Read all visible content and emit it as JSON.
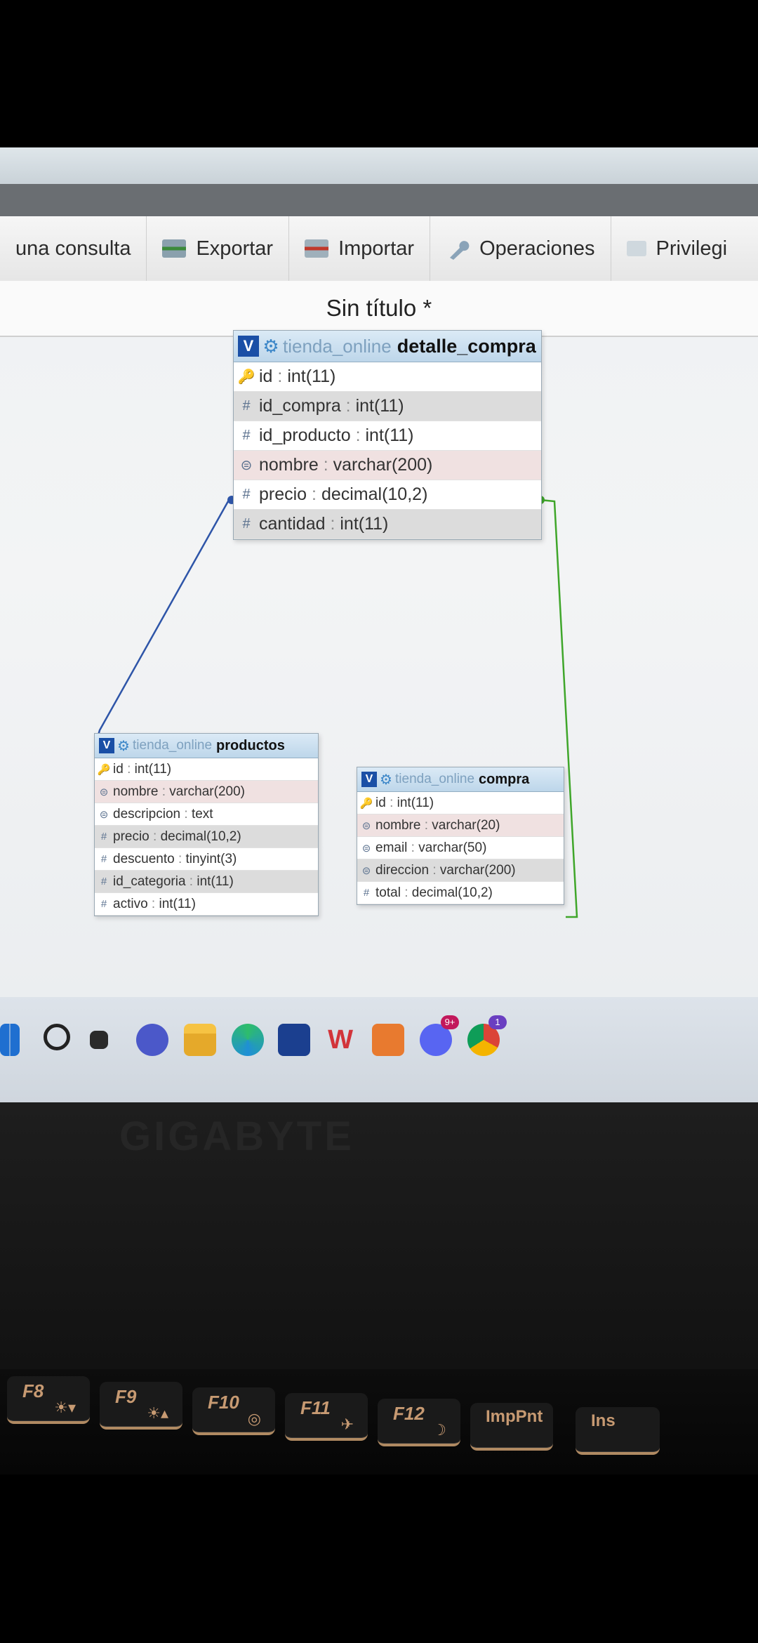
{
  "toolbar": {
    "tabs": [
      {
        "label": "una consulta",
        "icon": "query-icon"
      },
      {
        "label": "Exportar",
        "icon": "export-icon"
      },
      {
        "label": "Importar",
        "icon": "import-icon"
      },
      {
        "label": "Operaciones",
        "icon": "wrench-icon"
      },
      {
        "label": "Privilegi",
        "icon": "privileges-icon"
      }
    ]
  },
  "page": {
    "title": "Sin título *"
  },
  "tables": {
    "detalle_compra": {
      "db": "tienda_online",
      "name": "detalle_compra",
      "columns": [
        {
          "name": "id",
          "type": "int(11)",
          "icon": "key-icon"
        },
        {
          "name": "id_compra",
          "type": "int(11)",
          "icon": "hash-icon"
        },
        {
          "name": "id_producto",
          "type": "int(11)",
          "icon": "hash-icon"
        },
        {
          "name": "nombre",
          "type": "varchar(200)",
          "icon": "text-icon"
        },
        {
          "name": "precio",
          "type": "decimal(10,2)",
          "icon": "hash-icon"
        },
        {
          "name": "cantidad",
          "type": "int(11)",
          "icon": "hash-icon"
        }
      ]
    },
    "productos": {
      "db": "tienda_online",
      "name": "productos",
      "columns": [
        {
          "name": "id",
          "type": "int(11)",
          "icon": "key-icon"
        },
        {
          "name": "nombre",
          "type": "varchar(200)",
          "icon": "text-icon"
        },
        {
          "name": "descripcion",
          "type": "text",
          "icon": "text-icon"
        },
        {
          "name": "precio",
          "type": "decimal(10,2)",
          "icon": "hash-icon"
        },
        {
          "name": "descuento",
          "type": "tinyint(3)",
          "icon": "hash-icon"
        },
        {
          "name": "id_categoria",
          "type": "int(11)",
          "icon": "hash-icon"
        },
        {
          "name": "activo",
          "type": "int(11)",
          "icon": "hash-icon"
        }
      ]
    },
    "compra": {
      "db": "tienda_online",
      "name": "compra",
      "columns": [
        {
          "name": "id",
          "type": "int(11)",
          "icon": "key-icon"
        },
        {
          "name": "nombre",
          "type": "varchar(20)",
          "icon": "text-icon"
        },
        {
          "name": "email",
          "type": "varchar(50)",
          "icon": "text-icon"
        },
        {
          "name": "direccion",
          "type": "varchar(200)",
          "icon": "text-icon"
        },
        {
          "name": "total",
          "type": "decimal(10,2)",
          "icon": "hash-icon"
        }
      ]
    }
  },
  "header_badge": "V",
  "relations": [
    {
      "from": "detalle_compra.id_producto",
      "to": "productos.id",
      "color": "#2e55a8"
    },
    {
      "from": "detalle_compra.id_compra",
      "to": "compra.id",
      "color": "#3fa62a"
    }
  ],
  "taskbar": {
    "apps": [
      "windows-start-icon",
      "search-icon",
      "task-view-icon",
      "teams-chat-icon",
      "file-explorer-icon",
      "edge-icon",
      "store-icon",
      "wps-icon",
      "xampp-icon",
      "discord-icon",
      "chrome-icon"
    ],
    "discord_badge": "9+",
    "chrome_badge": "1"
  },
  "laptop": {
    "brand": "GIGABYTE"
  },
  "keyboard": {
    "keys": [
      {
        "label": "F8",
        "sub": "☀▾"
      },
      {
        "label": "F9",
        "sub": "☀▴"
      },
      {
        "label": "F10",
        "sub": "◎"
      },
      {
        "label": "F11",
        "sub": "✈"
      },
      {
        "label": "F12",
        "sub": "☽"
      },
      {
        "label": "ImpPnt",
        "sub": ""
      },
      {
        "label": "Ins",
        "sub": ""
      }
    ]
  }
}
